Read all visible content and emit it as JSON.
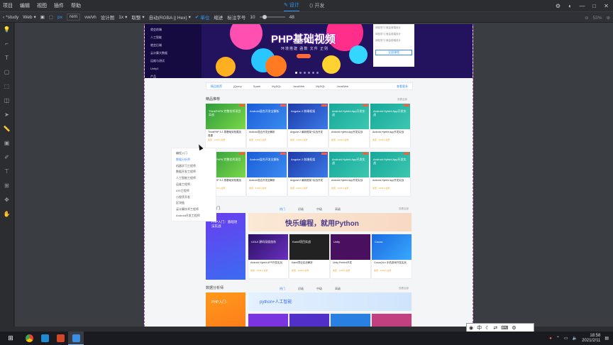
{
  "menu": [
    "项目",
    "编辑",
    "视图",
    "插件",
    "帮助"
  ],
  "modes": [
    {
      "label": "设计",
      "icon": "✎",
      "active": true
    },
    {
      "label": "开发",
      "icon": "⟨⟩",
      "active": false
    }
  ],
  "toolbar": {
    "project": "*study",
    "target": "Web",
    "unit_px": "px",
    "unit_rem": "rem",
    "unit_vw": "vw/vh",
    "scale_label": "设计图",
    "scale_value": "1x",
    "rounding": "取整",
    "color_format": "自动(RGBA || Hex)",
    "unit_toggle": "单位",
    "indent": "缩进",
    "font_label": "标注字号",
    "font_size": "10",
    "font_max": "48",
    "zoom": "53%"
  },
  "banner": {
    "title": "PHP基础视频",
    "subtitle": "环境搭建  函数  文件  正则",
    "side_menu": [
      "就会前端",
      "人工智能",
      "就会后端",
      "云计算大数据",
      "运维与测试",
      "Unity3",
      "产品"
    ],
    "login_lines": [
      "体验学习 就会前端设计",
      "体验学习 就会前端设计",
      "体验学习 就会前端设计"
    ],
    "login_button": "全部课程"
  },
  "tags": {
    "first": "精品推荐",
    "items": [
      "jQuery",
      "Spark",
      "MySQL",
      "JavaWeb",
      "MySQL",
      "JavaWeb"
    ],
    "more": "查看更多"
  },
  "sections": {
    "featured": "精品推荐",
    "featured_more": "查看全部",
    "coding": "编程入门",
    "coding_more": "查看全部",
    "data": "数据分析师",
    "data_more": "查看全部",
    "subtabs": [
      "热门",
      "初级",
      "中级",
      "高级"
    ]
  },
  "cards_row": [
    {
      "title": "ThinkPHP 5.1 零基础到拓展加强课",
      "thumb": "ThinkPHP5 完整优秀项目实战"
    },
    {
      "title": "Android混合开发全解析",
      "thumb": "Android混合开发全解析"
    },
    {
      "title": "Angular 2 最新框架+实战开发",
      "thumb": "Angular 2 前端框架"
    },
    {
      "title": "Android Hybrid App开发实战",
      "thumb": "Android Hybrid App开发实战"
    },
    {
      "title": "Android Hybrid App开发实战",
      "thumb": "Android Hybrid App开发实战"
    }
  ],
  "card_meta": "免费 · 1234人在学",
  "floatnav": {
    "items": [
      "编程入门",
      "数据分析师",
      "机器学习工程师",
      "数据开发工程师",
      "人工智能工程师",
      "运维工程师",
      "iOS工程师",
      "小程序开发",
      "区块链",
      "云计算技术工程师",
      "Android开发工程师"
    ],
    "active_index": 1
  },
  "coding_banner": "快乐编程，就用Python",
  "coding_side": "PHP入门：基础语法实战",
  "coding_cards": [
    {
      "title": "Android Hybrid APP开发实战",
      "thumb": "UGUI 源码深度剖析"
    },
    {
      "title": "Kamil项目实战解析",
      "thumb": "Kamil项目实战"
    },
    {
      "title": "Unity Perfect开发",
      "thumb": "Unity"
    },
    {
      "title": "Cocos2d-x 手机游戏开发实战",
      "thumb": "Cocos"
    }
  ],
  "data_banner": "python+人工智能",
  "data_side": "PHP入门：",
  "ime": [
    "中",
    "☾",
    "⇄",
    "⌨",
    "⚙"
  ],
  "tray": {
    "time": "18:58",
    "date": "2021/2/11"
  },
  "colors": {
    "accent": "#2d9bff",
    "banner_bg": "#23125e"
  }
}
